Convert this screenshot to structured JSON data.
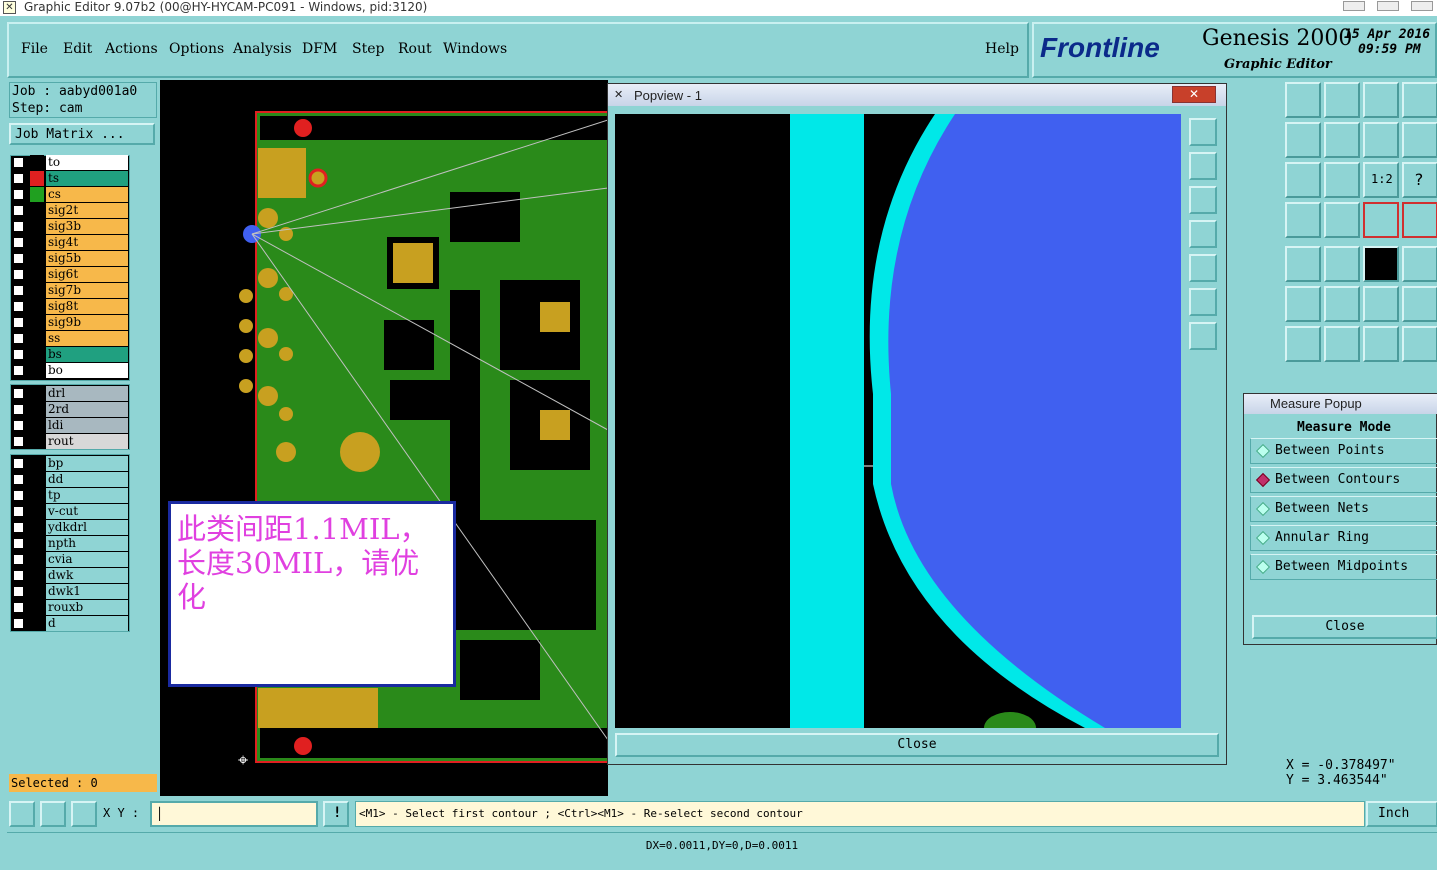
{
  "window": {
    "title": "Graphic Editor 9.07b2 (00@HY-HYCAM-PC091 - Windows, pid:3120)"
  },
  "menu": {
    "items": [
      "File",
      "Edit",
      "Actions",
      "Options",
      "Analysis",
      "DFM",
      "Step",
      "Rout",
      "Windows"
    ],
    "help": "Help"
  },
  "brand": {
    "logo": "Frontline",
    "product": "Genesis 2000",
    "subtitle": "Graphic Editor",
    "date": "15 Apr 2016",
    "time": "09:59 PM"
  },
  "job": {
    "job_line": "Job : aabyd001a0",
    "step_line": "Step: cam",
    "matrix_button": "Job Matrix ..."
  },
  "layers": [
    {
      "name": "to",
      "swatch": "#000000",
      "bg": "#ffffff"
    },
    {
      "name": "ts",
      "swatch": "#e02020",
      "bg": "#20a080"
    },
    {
      "name": "cs",
      "swatch": "#20a020",
      "bg": "#f7b84a"
    },
    {
      "name": "sig2t",
      "swatch": "#000000",
      "bg": "#f7b84a"
    },
    {
      "name": "sig3b",
      "swatch": "#000000",
      "bg": "#f7b84a"
    },
    {
      "name": "sig4t",
      "swatch": "#000000",
      "bg": "#f7b84a"
    },
    {
      "name": "sig5b",
      "swatch": "#000000",
      "bg": "#f7b84a"
    },
    {
      "name": "sig6t",
      "swatch": "#000000",
      "bg": "#f7b84a"
    },
    {
      "name": "sig7b",
      "swatch": "#000000",
      "bg": "#f7b84a"
    },
    {
      "name": "sig8t",
      "swatch": "#000000",
      "bg": "#f7b84a"
    },
    {
      "name": "sig9b",
      "swatch": "#000000",
      "bg": "#f7b84a"
    },
    {
      "name": "ss",
      "swatch": "#000000",
      "bg": "#f7b84a"
    },
    {
      "name": "bs",
      "swatch": "#000000",
      "bg": "#20a080"
    },
    {
      "name": "bo",
      "swatch": "#000000",
      "bg": "#ffffff"
    }
  ],
  "layers2": [
    "drl",
    "2rd",
    "ldi",
    "rout"
  ],
  "layers3": [
    "bp",
    "dd",
    "tp",
    "v-cut",
    "ydkdrl",
    "npth",
    "cvia",
    "dwk",
    "dwk1",
    "rouxb",
    "d"
  ],
  "selected": "Selected : 0",
  "note": "此类间距1.1MIL，长度30MIL，请优化",
  "popview": {
    "title": "Popview - 1",
    "close": "Close"
  },
  "measure": {
    "title": "Measure Popup",
    "mode_label": "Measure Mode",
    "options": [
      "Between Points",
      "Between Contours",
      "Between Nets",
      "Annular Ring",
      "Between Midpoints"
    ],
    "active_index": 1,
    "close": "Close"
  },
  "coords": {
    "x": "X = -0.378497\"",
    "y": "Y = 3.463544\""
  },
  "status": {
    "xy_label": "X Y :",
    "prompt": "<M1> - Select first contour ; <Ctrl><M1> - Re-select second contour",
    "units": "Inch",
    "measure_result": "DX=0.0011,DY=0,D=0.0011"
  },
  "colors": {
    "panel": "#8fd4d4",
    "copper": "#c8a020",
    "soldermask": "#2a8a1a",
    "cyan_feature": "#00e8e8",
    "blue_feature": "#4060f0"
  }
}
